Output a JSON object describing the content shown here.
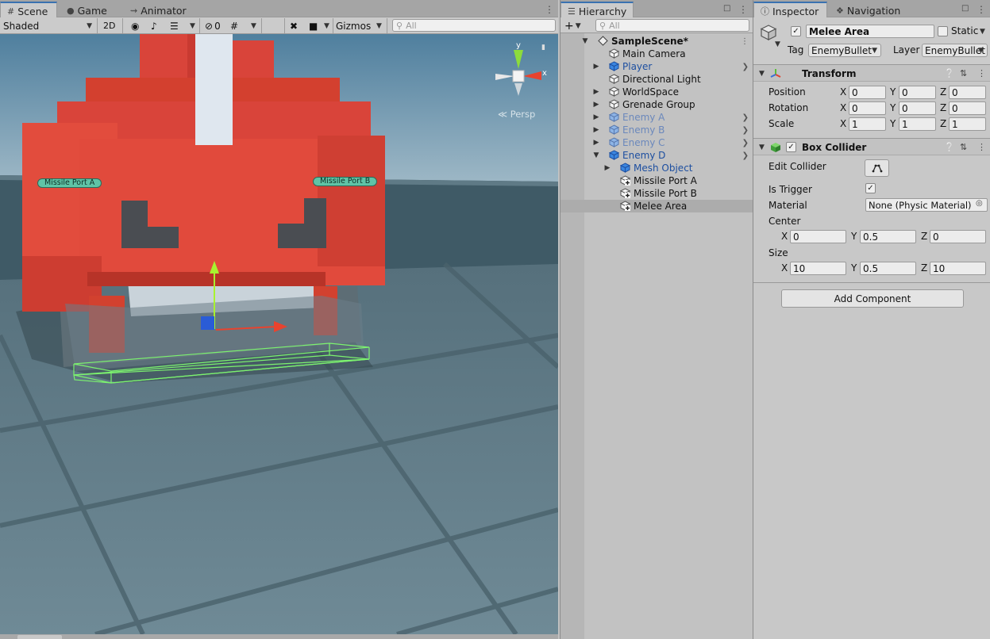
{
  "scene_panel": {
    "tabs": [
      {
        "label": "Scene",
        "icon": "grid-icon"
      },
      {
        "label": "Game",
        "icon": "gamepad-icon"
      },
      {
        "label": "Animator",
        "icon": "animator-icon"
      }
    ],
    "toolbar": {
      "shading_mode": "Shaded",
      "mode_2d": "2D",
      "hidden_count": "0",
      "gizmos_label": "Gizmos",
      "search_placeholder": "All"
    },
    "viewport": {
      "labels": [
        "Missile Port A",
        "Missile Port B"
      ],
      "projection": "Persp",
      "gizmo_axes": {
        "y": "y",
        "x": "x"
      }
    }
  },
  "hierarchy": {
    "tab_label": "Hierarchy",
    "search_placeholder": "All",
    "items": [
      {
        "label": "SampleScene*",
        "type": "scene",
        "expanded": true
      },
      {
        "label": "Main Camera",
        "type": "object"
      },
      {
        "label": "Player",
        "type": "prefab",
        "has_children": true
      },
      {
        "label": "Directional Light",
        "type": "object"
      },
      {
        "label": "WorldSpace",
        "type": "object",
        "has_children": true
      },
      {
        "label": "Grenade Group",
        "type": "object",
        "has_children": true
      },
      {
        "label": "Enemy A",
        "type": "prefab-dim",
        "has_children": true
      },
      {
        "label": "Enemy B",
        "type": "prefab-dim",
        "has_children": true
      },
      {
        "label": "Enemy C",
        "type": "prefab-dim",
        "has_children": true
      },
      {
        "label": "Enemy D",
        "type": "prefab",
        "expanded": true
      },
      {
        "label": "Mesh Object",
        "type": "prefab",
        "has_children": true
      },
      {
        "label": "Missile Port A",
        "type": "added-object"
      },
      {
        "label": "Missile Port B",
        "type": "added-object"
      },
      {
        "label": "Melee Area",
        "type": "added-object",
        "selected": true
      }
    ]
  },
  "inspector": {
    "tabs": [
      {
        "label": "Inspector",
        "icon": "info-icon"
      },
      {
        "label": "Navigation",
        "icon": "navigation-icon"
      }
    ],
    "object_name": "Melee Area",
    "active": true,
    "static_label": "Static",
    "static": false,
    "tag_label": "Tag",
    "tag_value": "EnemyBullet",
    "layer_label": "Layer",
    "layer_value": "EnemyBullet",
    "transform": {
      "title": "Transform",
      "rows": [
        {
          "label": "Position",
          "x": "0",
          "y": "0",
          "z": "0"
        },
        {
          "label": "Rotation",
          "x": "0",
          "y": "0",
          "z": "0"
        },
        {
          "label": "Scale",
          "x": "1",
          "y": "1",
          "z": "1"
        }
      ]
    },
    "box_collider": {
      "title": "Box Collider",
      "enabled": true,
      "edit_collider_label": "Edit Collider",
      "is_trigger_label": "Is Trigger",
      "is_trigger": true,
      "material_label": "Material",
      "material_value": "None (Physic Material)",
      "center_label": "Center",
      "center": {
        "x": "0",
        "y": "0.5",
        "z": "0"
      },
      "size_label": "Size",
      "size": {
        "x": "10",
        "y": "0.5",
        "z": "10"
      }
    },
    "add_component_label": "Add Component",
    "axis_labels": {
      "x": "X",
      "y": "Y",
      "z": "Z"
    }
  }
}
